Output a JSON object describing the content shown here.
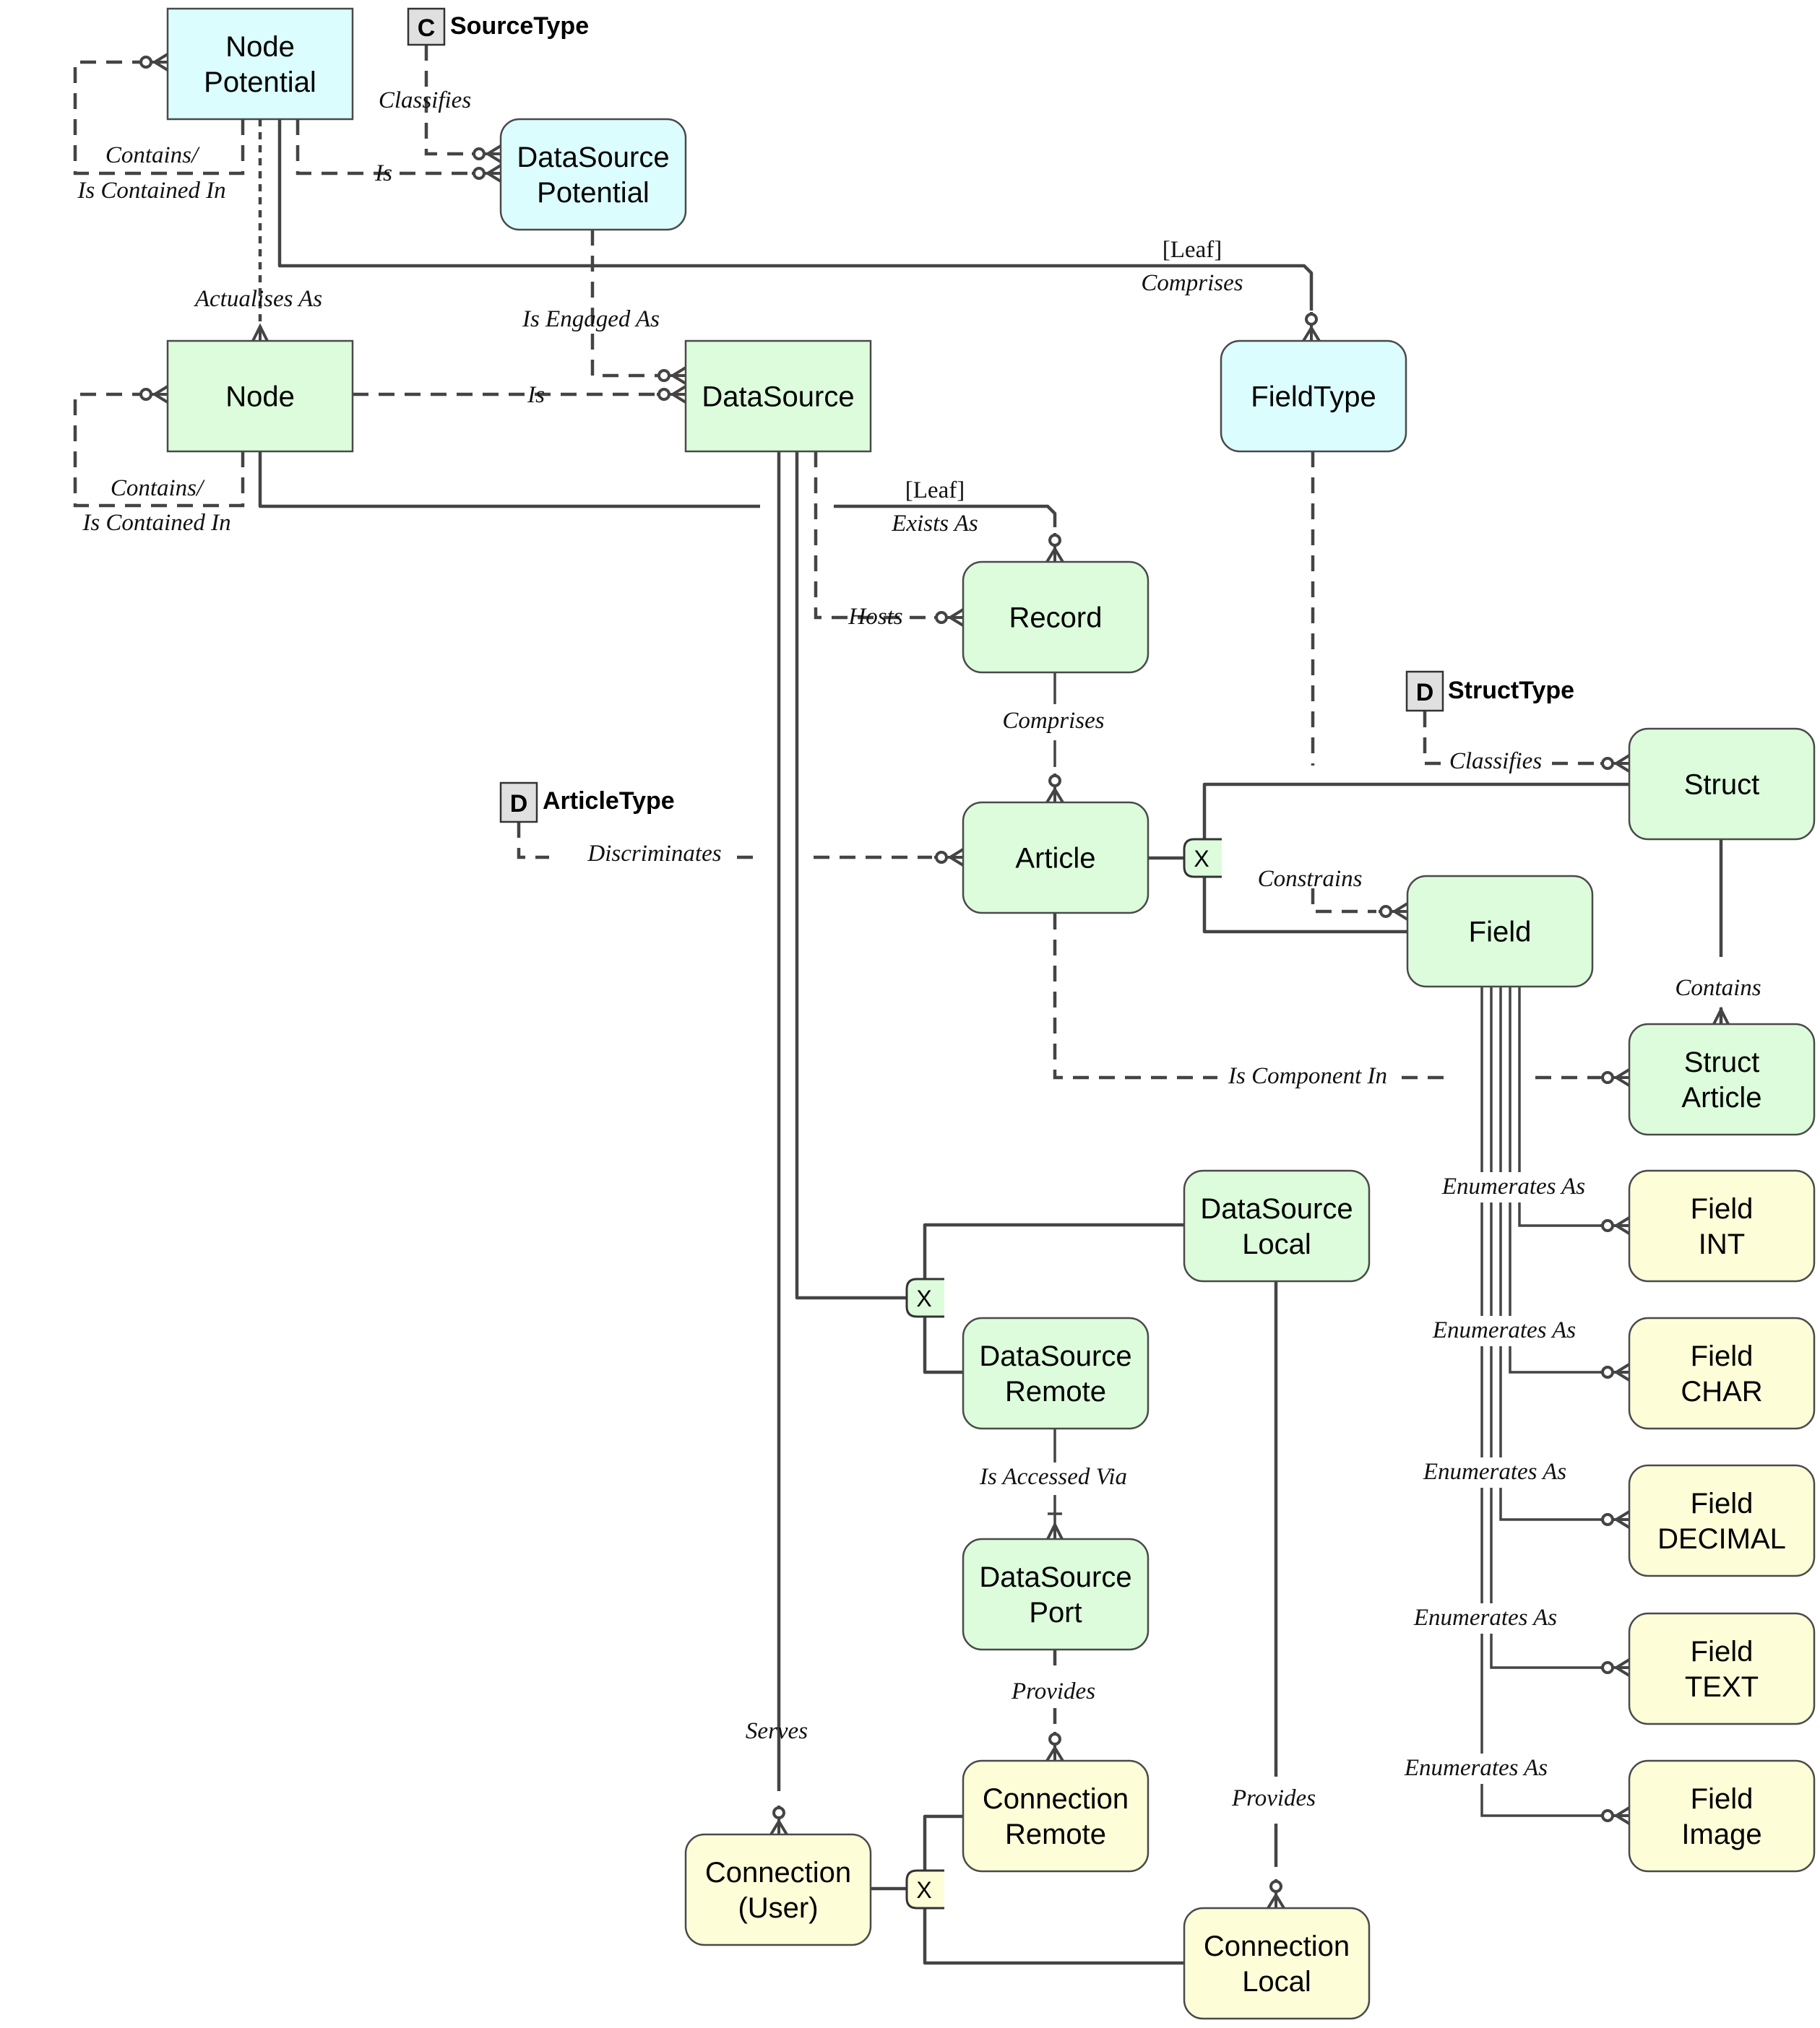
{
  "diagram": {
    "colors": {
      "potential": "#dbfdfd",
      "actual": "#dcfcdc",
      "connection": "#fdfdd8",
      "tag": "#e0e0e0",
      "line": "#444444"
    },
    "entities": {
      "node_potential": [
        "Node",
        "Potential"
      ],
      "datasource_potential": [
        "DataSource",
        "Potential"
      ],
      "node": [
        "Node"
      ],
      "datasource": [
        "DataSource"
      ],
      "fieldtype": [
        "FieldType"
      ],
      "record": [
        "Record"
      ],
      "article": [
        "Article"
      ],
      "struct": [
        "Struct"
      ],
      "field": [
        "Field"
      ],
      "struct_article": [
        "Struct",
        "Article"
      ],
      "datasource_local": [
        "DataSource",
        "Local"
      ],
      "datasource_remote": [
        "DataSource",
        "Remote"
      ],
      "datasource_port": [
        "DataSource",
        "Port"
      ],
      "connection_remote": [
        "Connection",
        "Remote"
      ],
      "connection_user": [
        "Connection",
        "(User)"
      ],
      "connection_local": [
        "Connection",
        "Local"
      ],
      "field_int": [
        "Field",
        "INT"
      ],
      "field_char": [
        "Field",
        "CHAR"
      ],
      "field_decimal": [
        "Field",
        "DECIMAL"
      ],
      "field_text": [
        "Field",
        "TEXT"
      ],
      "field_image": [
        "Field",
        "Image"
      ]
    },
    "tags": {
      "sourcetype": {
        "letter": "C",
        "name": "SourceType"
      },
      "articletype": {
        "letter": "D",
        "name": "ArticleType"
      },
      "structtype": {
        "letter": "D",
        "name": "StructType"
      }
    },
    "exclusive_marker": "X",
    "relationships": {
      "np_contains_1": "Contains/",
      "np_contains_2": "Is Contained In",
      "classifies_source": "Classifies",
      "np_is": "Is",
      "leaf_1": "[Leaf]",
      "comprises_fieldtype": "Comprises",
      "actualises_as": "Actualises As",
      "is_engaged_as": "Is Engaged As",
      "node_is": "Is",
      "node_contains_1": "Contains/",
      "node_contains_2": "Is Contained In",
      "leaf_2": "[Leaf]",
      "exists_as": "Exists As",
      "hosts": "Hosts",
      "comprises_article": "Comprises",
      "discriminates": "Discriminates",
      "classifies_struct": "Classifies",
      "constrains": "Constrains",
      "contains_struct": "Contains",
      "is_component_in": "Is Component In",
      "enumerates_int": "Enumerates As",
      "enumerates_char": "Enumerates As",
      "enumerates_decimal": "Enumerates As",
      "enumerates_text": "Enumerates As",
      "enumerates_image": "Enumerates As",
      "is_accessed_via": "Is Accessed Via",
      "provides_remote": "Provides",
      "serves": "Serves",
      "provides_local": "Provides"
    }
  }
}
